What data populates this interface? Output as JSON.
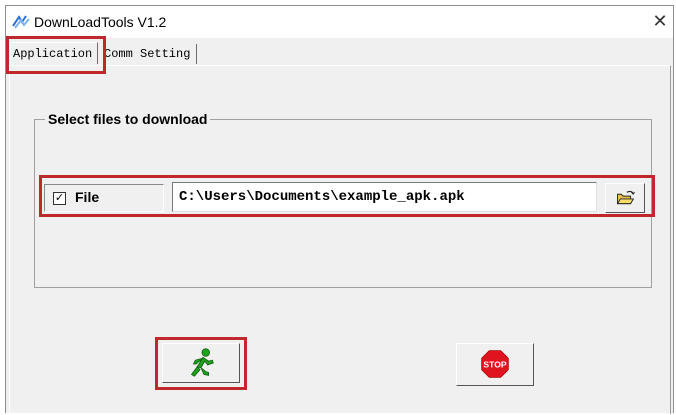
{
  "window": {
    "title": "DownLoadTools V1.2",
    "close_glyph": "✕"
  },
  "tabs": [
    {
      "label": "Application",
      "active": true
    },
    {
      "label": "Comm Setting",
      "active": false
    }
  ],
  "download_group": {
    "legend": "Select files to download",
    "file_checkbox": {
      "label": "File",
      "checked": true,
      "mark": "✓"
    },
    "path_value": "C:\\Users\\Documents\\example_apk.apk",
    "browse_icon": "open-folder-icon"
  },
  "actions": {
    "run_icon": "running-man-icon",
    "stop_icon": "stop-sign-icon",
    "stop_text": "STOP"
  },
  "colors": {
    "highlight": "#c0282d",
    "run_icon": "#1ea21e",
    "stop_icon": "#e0141e"
  }
}
